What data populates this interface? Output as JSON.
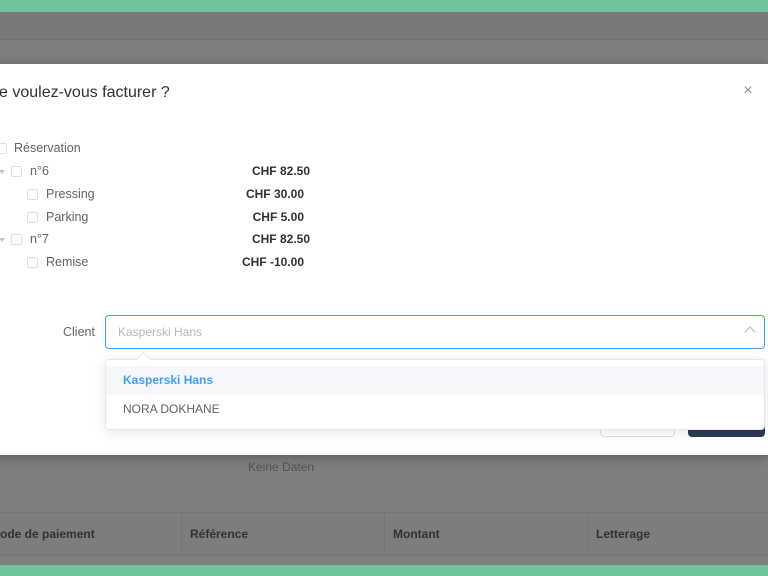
{
  "background": {
    "empty_text": "Keine Daten",
    "table_headers": [
      "ode de paiement",
      "Référence",
      "Montant",
      "Letterage"
    ]
  },
  "dialog": {
    "title": "e voulez-vous facturer ?",
    "close_icon": "close-icon",
    "tree": {
      "root": {
        "label": "Réservation"
      },
      "rooms": [
        {
          "label": "n°6",
          "price": "CHF 82.50",
          "children": [
            {
              "label": "Pressing",
              "price": "CHF 30.00"
            },
            {
              "label": "Parking",
              "price": "CHF 5.00"
            }
          ]
        },
        {
          "label": "n°7",
          "price": "CHF 82.50",
          "children": [
            {
              "label": "Remise",
              "price": "CHF -10.00"
            }
          ]
        }
      ]
    },
    "client": {
      "label": "Client",
      "placeholder": "Kasperski Hans",
      "arrow_icon": "chevron-up-icon",
      "options": [
        "Kasperski Hans",
        "NORA DOKHANE"
      ],
      "selected": "Kasperski Hans"
    }
  },
  "colors": {
    "accent": "#409eff",
    "primary_button": "#2b3a55",
    "frame": "#6fc39a"
  }
}
